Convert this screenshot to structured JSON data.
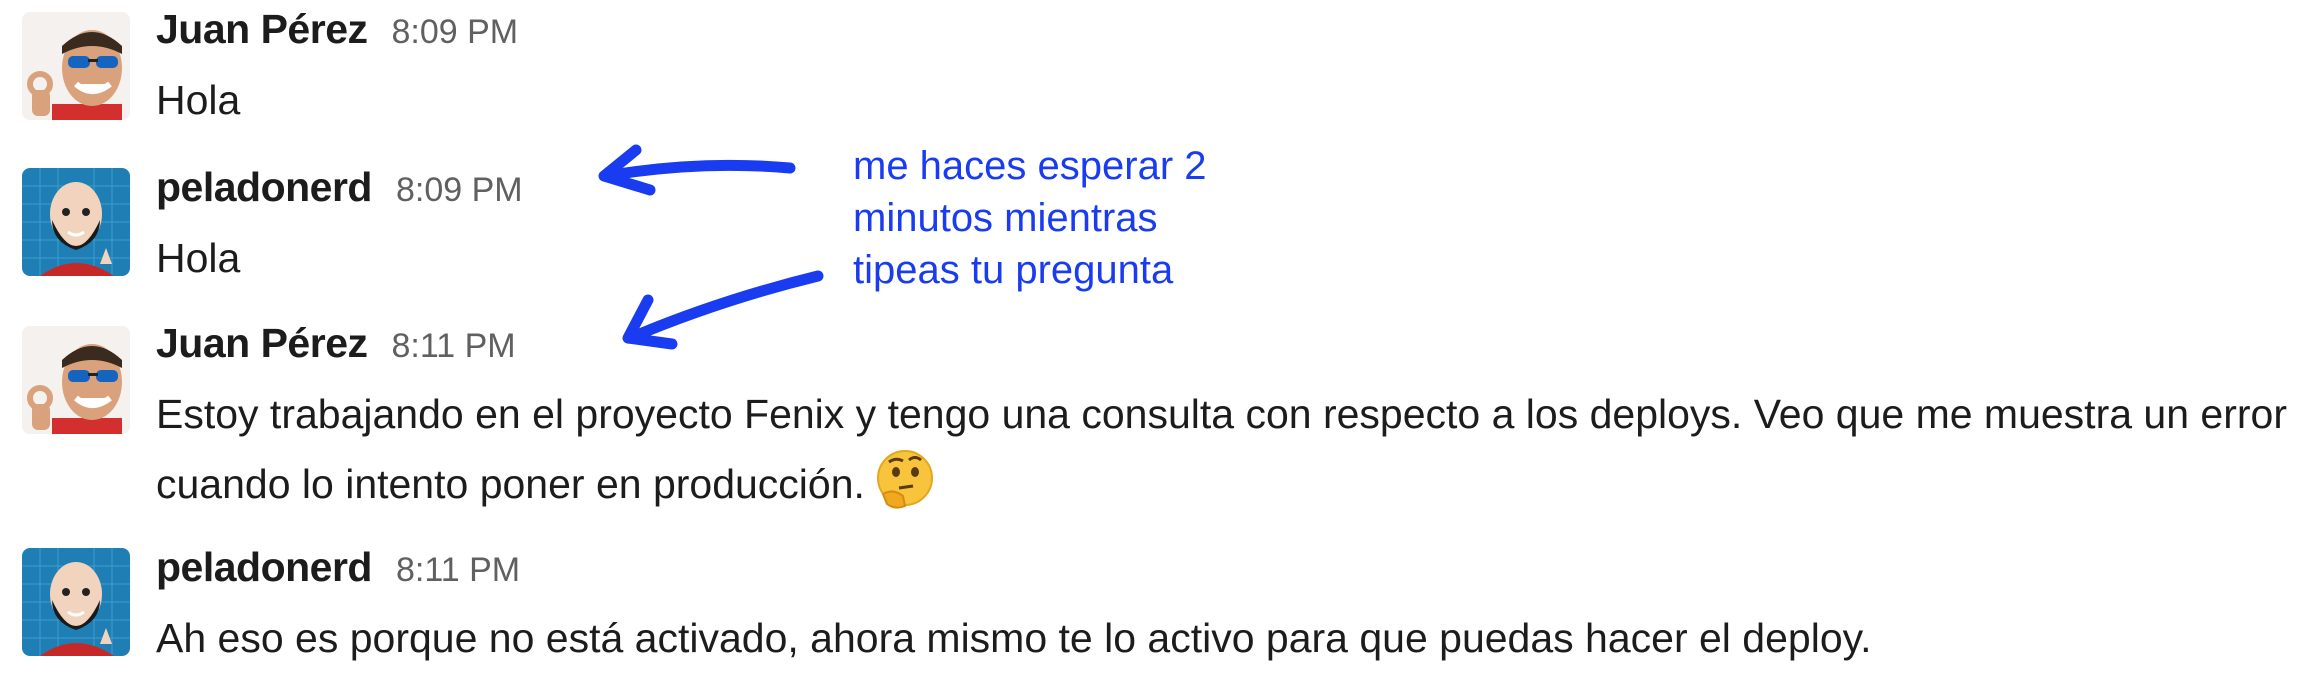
{
  "messages": [
    {
      "author": "Juan Pérez",
      "time": "8:09 PM",
      "text": "Hola",
      "avatar": "juan-avatar"
    },
    {
      "author": "peladonerd",
      "time": "8:09 PM",
      "text": "Hola",
      "avatar": "peladonerd-avatar"
    },
    {
      "author": "Juan Pérez",
      "time": "8:11 PM",
      "text": "Estoy trabajando en el proyecto Fenix y tengo una consulta con respecto a los deploys. Veo que me muestra un error cuando lo intento poner en producción.",
      "emoji": "thinking-face-emoji",
      "avatar": "juan-avatar"
    },
    {
      "author": "peladonerd",
      "time": "8:11 PM",
      "text": "Ah eso es porque no está activado, ahora mismo te lo activo para que puedas hacer el deploy.",
      "avatar": "peladonerd-avatar"
    }
  ],
  "annotation": {
    "text": "me haces esperar 2\nminutos mientras\ntipeas tu pregunta",
    "color": "#1a3cf0"
  },
  "colors": {
    "author": "#1d1c1d",
    "timestamp": "#616061",
    "peladonerd_avatar_bg": "#1f7fb5"
  }
}
